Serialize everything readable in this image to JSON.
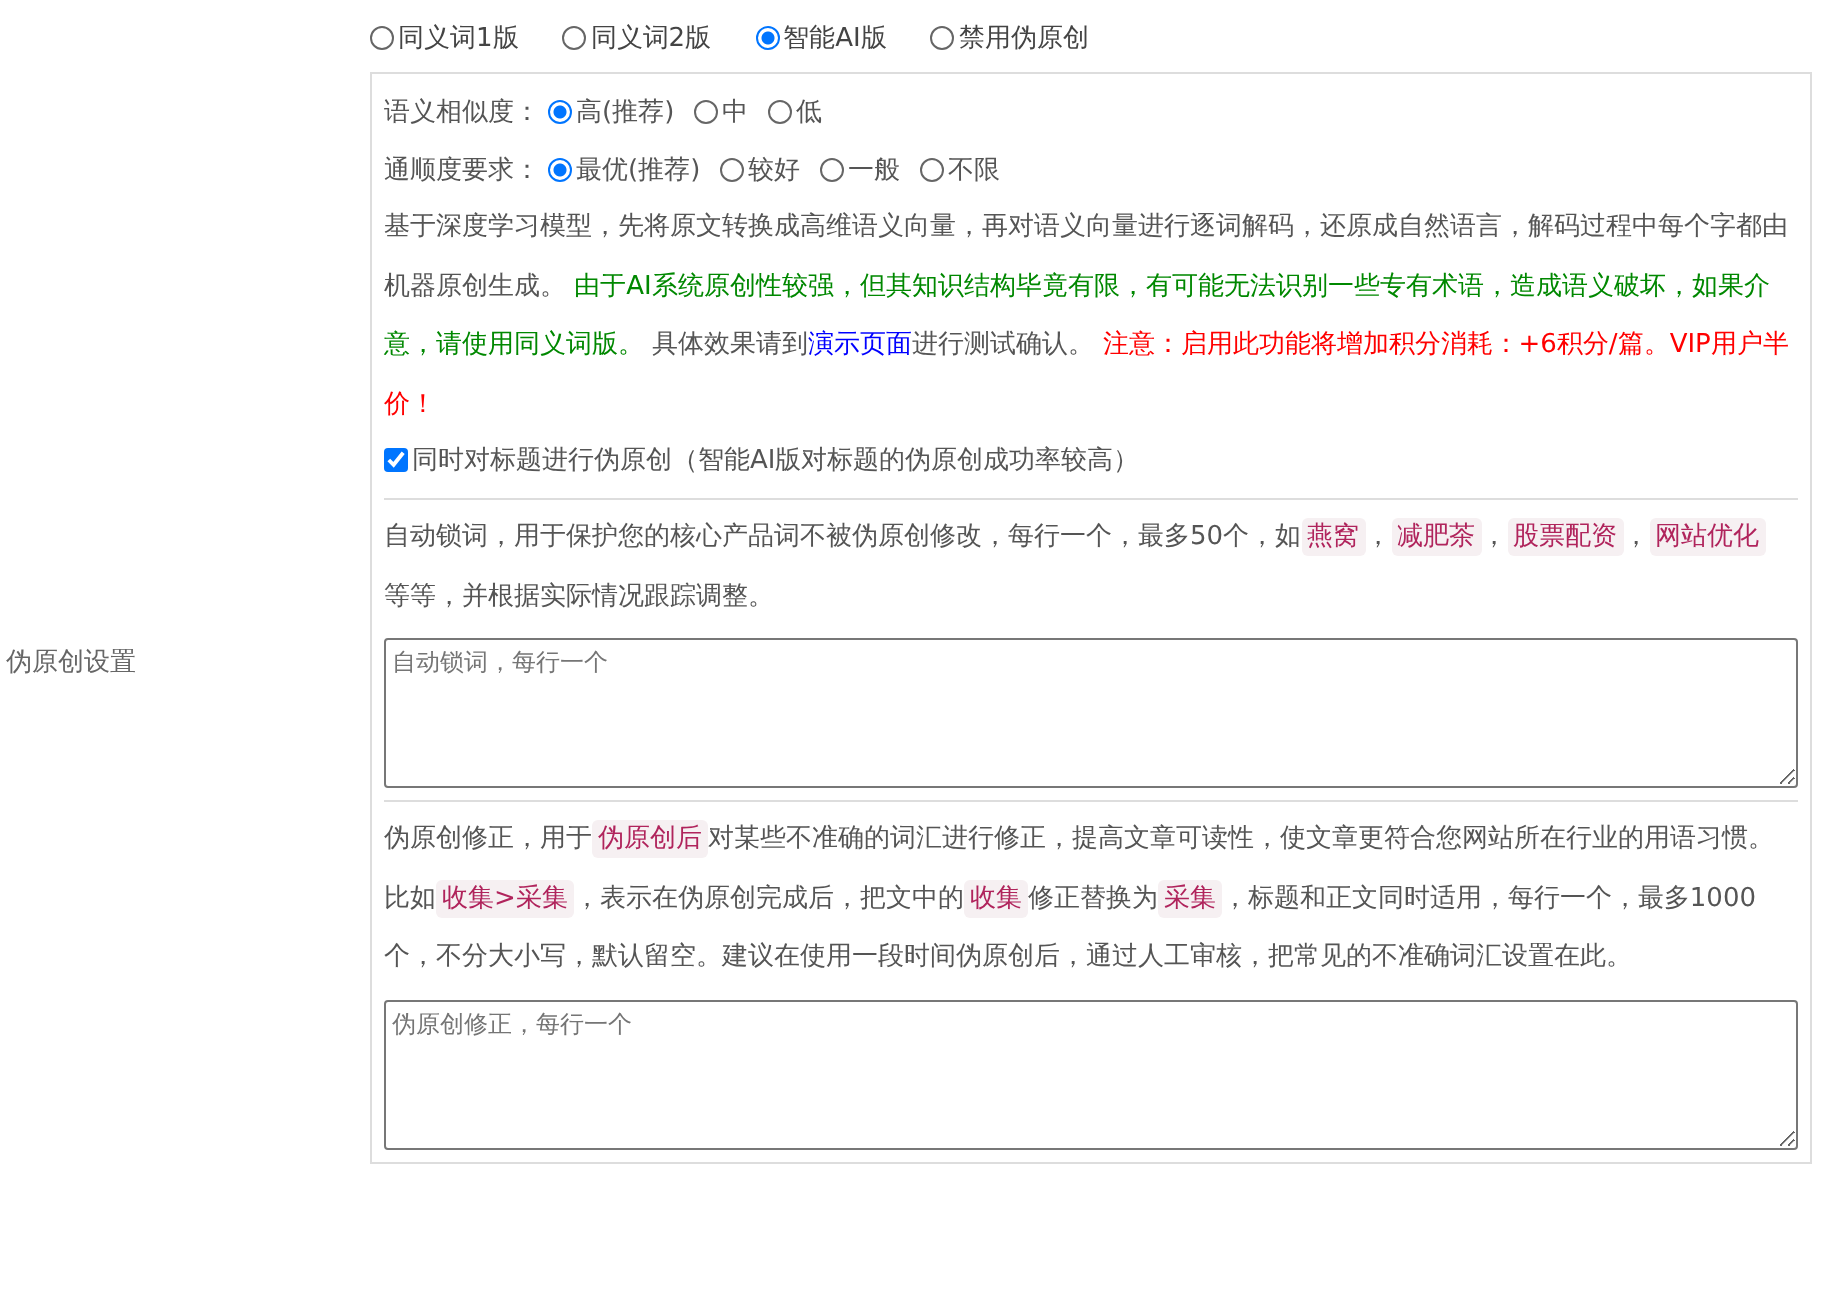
{
  "label": "伪原创设置",
  "modes": [
    {
      "label": "同义词1版",
      "selected": false
    },
    {
      "label": "同义词2版",
      "selected": false
    },
    {
      "label": "智能AI版",
      "selected": true
    },
    {
      "label": "禁用伪原创",
      "selected": false
    }
  ],
  "option_groups": [
    {
      "label": "语义相似度：",
      "options": [
        {
          "label": "高(推荐)",
          "selected": true
        },
        {
          "label": "中",
          "selected": false
        },
        {
          "label": "低",
          "selected": false
        }
      ]
    },
    {
      "label": "通顺度要求：",
      "options": [
        {
          "label": "最优(推荐)",
          "selected": true
        },
        {
          "label": "较好",
          "selected": false
        },
        {
          "label": "一般",
          "selected": false
        },
        {
          "label": "不限",
          "selected": false
        }
      ]
    }
  ],
  "description": [
    {
      "kind": "plain",
      "text": "基于深度学习模型，先将原文转换成高维语义向量，再对语义向量进行逐词解码，还原成自然语言，解码过程中每个字都由机器原创生成。"
    },
    {
      "kind": "green",
      "text": " 由于AI系统原创性较强，但其知识结构毕竟有限，有可能无法识别一些专有术语，造成语义破坏，如果介意，请使用同义词版。"
    },
    {
      "kind": "plain",
      "text": " 具体效果请到"
    },
    {
      "kind": "link",
      "text": "演示页面"
    },
    {
      "kind": "plain",
      "text": "进行测试确认。"
    },
    {
      "kind": "red",
      "text": " 注意：启用此功能将增加积分消耗：+6积分/篇。VIP用户半价！"
    }
  ],
  "title_option": {
    "label": "同时对标题进行伪原创（智能AI版对标题的伪原创成功率较高）",
    "checked": true
  },
  "lock_words": {
    "text": [
      {
        "kind": "plain",
        "text": "自动锁词，用于保护您的核心产品词不被伪原创修改，每行一个，最多50个，如"
      },
      {
        "kind": "tag",
        "text": "燕窝"
      },
      {
        "kind": "plain",
        "text": "，"
      },
      {
        "kind": "tag",
        "text": "减肥茶"
      },
      {
        "kind": "plain",
        "text": "，"
      },
      {
        "kind": "tag",
        "text": "股票配资"
      },
      {
        "kind": "plain",
        "text": "，"
      },
      {
        "kind": "tag",
        "text": "网站优化"
      },
      {
        "kind": "plain",
        "text": " 等等，并根据实际情况跟踪调整。"
      }
    ],
    "placeholder": "自动锁词，每行一个"
  },
  "correction": {
    "text": [
      {
        "kind": "plain",
        "text": "伪原创修正，用于"
      },
      {
        "kind": "tag",
        "text": "伪原创后"
      },
      {
        "kind": "plain",
        "text": "对某些不准确的词汇进行修正，提高文章可读性，使文章更符合您网站所在行业的用语习惯。比如"
      },
      {
        "kind": "tag",
        "text": "收集>采集"
      },
      {
        "kind": "plain",
        "text": "，表示在伪原创完成后，把文中的"
      },
      {
        "kind": "tag",
        "text": "收集"
      },
      {
        "kind": "plain",
        "text": "修正替换为"
      },
      {
        "kind": "tag",
        "text": "采集"
      },
      {
        "kind": "plain",
        "text": "，标题和正文同时适用，每行一个，最多1000个，不分大小写，默认留空。建议在使用一段时间伪原创后，通过人工审核，把常见的不准确词汇设置在此。"
      }
    ],
    "placeholder": "伪原创修正，每行一个"
  }
}
